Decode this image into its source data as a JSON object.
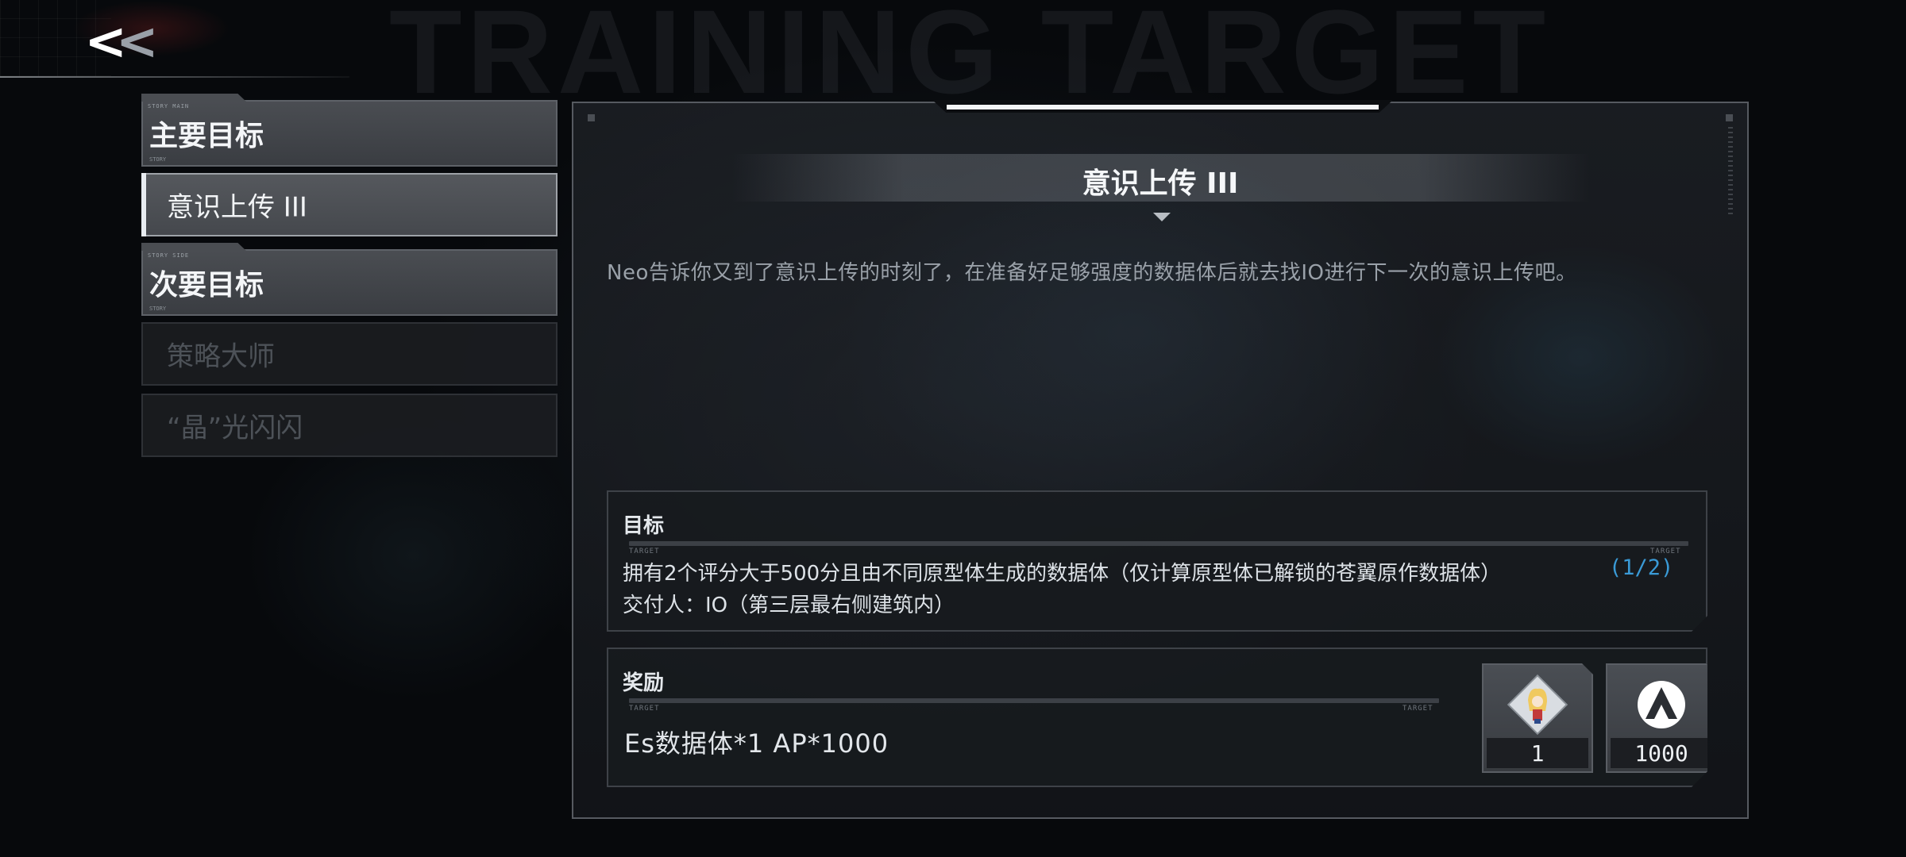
{
  "header": {
    "back_label": "<<",
    "watermark": "TRAINING TARGET"
  },
  "sidebar": {
    "sections": [
      {
        "header": "主要目标",
        "items": [
          {
            "label": "意识上传 III",
            "active": true
          }
        ]
      },
      {
        "header": "次要目标",
        "items": [
          {
            "label": "策略大师",
            "active": false
          },
          {
            "label": "“晶”光闪闪",
            "active": false
          }
        ]
      }
    ]
  },
  "quest": {
    "title": "意识上传 III",
    "description": "Neo告诉你又到了意识上传的时刻了，在准备好足够强度的数据体后就去找IO进行下一次的意识上传吧。",
    "objective": {
      "heading": "目标",
      "rule_tag_left": "TARGET",
      "rule_tag_right": "TARGET",
      "text": "拥有2个评分大于500分且由不同原型体生成的数据体（仅计算原型体已解锁的苍翼原作数据体）",
      "progress": "(1/2)",
      "giver": "交付人：IO（第三层最右侧建筑内）"
    },
    "reward": {
      "heading": "奖励",
      "rule_tag_left": "TARGET",
      "rule_tag_right": "TARGET",
      "text": "Es数据体*1  AP*1000",
      "items": [
        {
          "icon": "character-portrait-icon",
          "count": "1"
        },
        {
          "icon": "ap-logo-icon",
          "count": "1000"
        }
      ]
    }
  },
  "colors": {
    "accent_blue": "#3a9ad6",
    "panel_border": "#565a60",
    "active_item_bg": "#4f5257"
  }
}
